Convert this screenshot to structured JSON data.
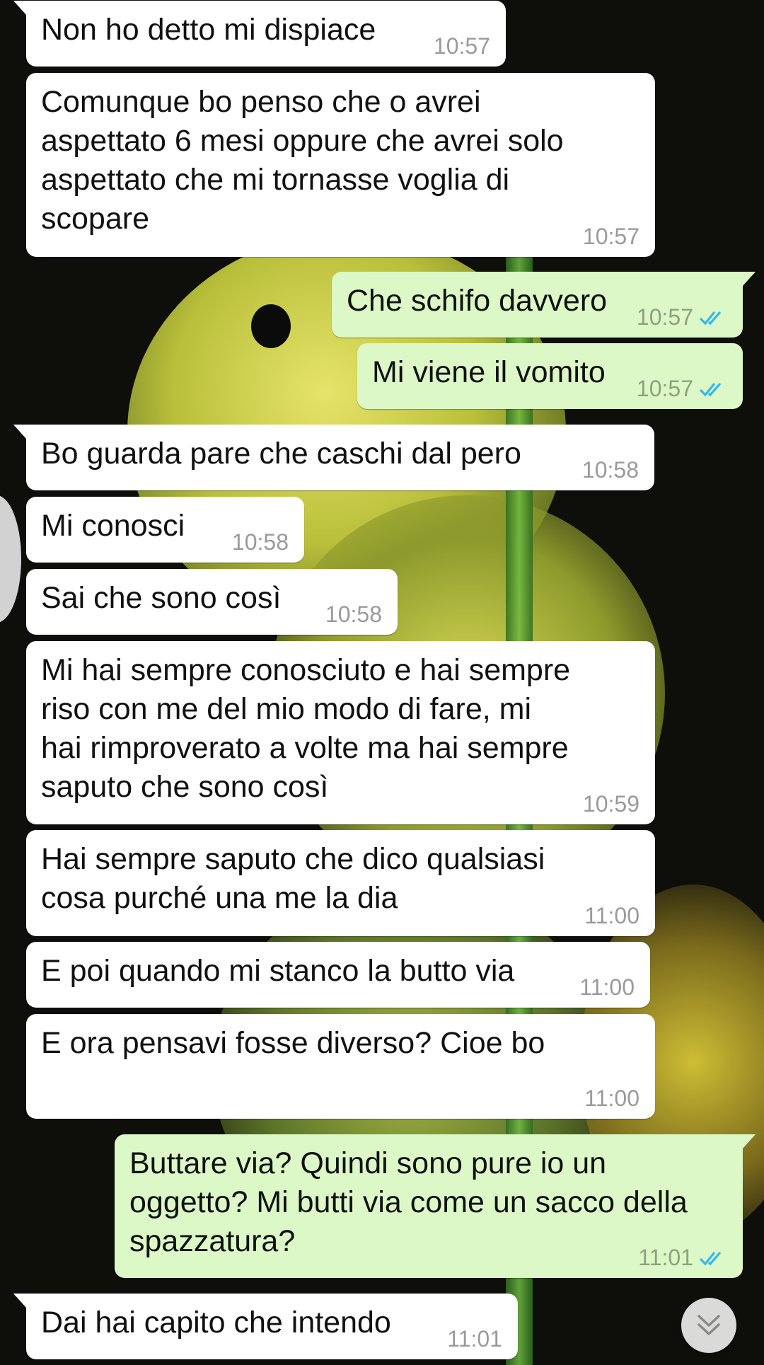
{
  "messages": [
    {
      "dir": "in",
      "text": "Non ho detto mi dispiace",
      "time": "10:57"
    },
    {
      "dir": "in",
      "text": "Comunque bo penso che o avrei\naspettato 6 mesi oppure che avrei solo\naspettato che mi tornasse voglia di\nscopare",
      "time": "10:57"
    },
    {
      "dir": "out",
      "text": "Che schifo davvero",
      "time": "10:57",
      "status": "read"
    },
    {
      "dir": "out",
      "text": "Mi viene il vomito",
      "time": "10:57",
      "status": "read"
    },
    {
      "dir": "in",
      "text": "Bo guarda pare che caschi dal pero",
      "time": "10:58"
    },
    {
      "dir": "in",
      "text": "Mi conosci",
      "time": "10:58"
    },
    {
      "dir": "in",
      "text": "Sai che sono così",
      "time": "10:58"
    },
    {
      "dir": "in",
      "text": "Mi hai sempre conosciuto e hai sempre\nriso con me del mio modo di fare, mi\nhai rimproverato a volte ma hai sempre\nsaputo che sono così",
      "time": "10:59"
    },
    {
      "dir": "in",
      "text": "Hai sempre saputo che dico qualsiasi\ncosa purché una me la dia",
      "time": "11:00"
    },
    {
      "dir": "in",
      "text": "E poi quando mi stanco la butto via",
      "time": "11:00"
    },
    {
      "dir": "in",
      "text": "E ora pensavi fosse diverso? Cioe bo",
      "time": "11:00"
    },
    {
      "dir": "out",
      "text": "Buttare via? Quindi sono pure io un\noggetto? Mi butti via come un sacco della\nspazzatura?",
      "time": "11:01",
      "status": "read"
    },
    {
      "dir": "in",
      "text": "Dai hai capito che intendo",
      "time": "11:01"
    }
  ],
  "colors": {
    "incoming_bubble": "#ffffff",
    "outgoing_bubble": "#dcf8c6",
    "read_ticks": "#34b7f1",
    "timestamp": "#9a9a9a"
  },
  "icons": {
    "read_receipt": "double-check-icon",
    "scroll_down": "double-chevron-down-icon"
  }
}
